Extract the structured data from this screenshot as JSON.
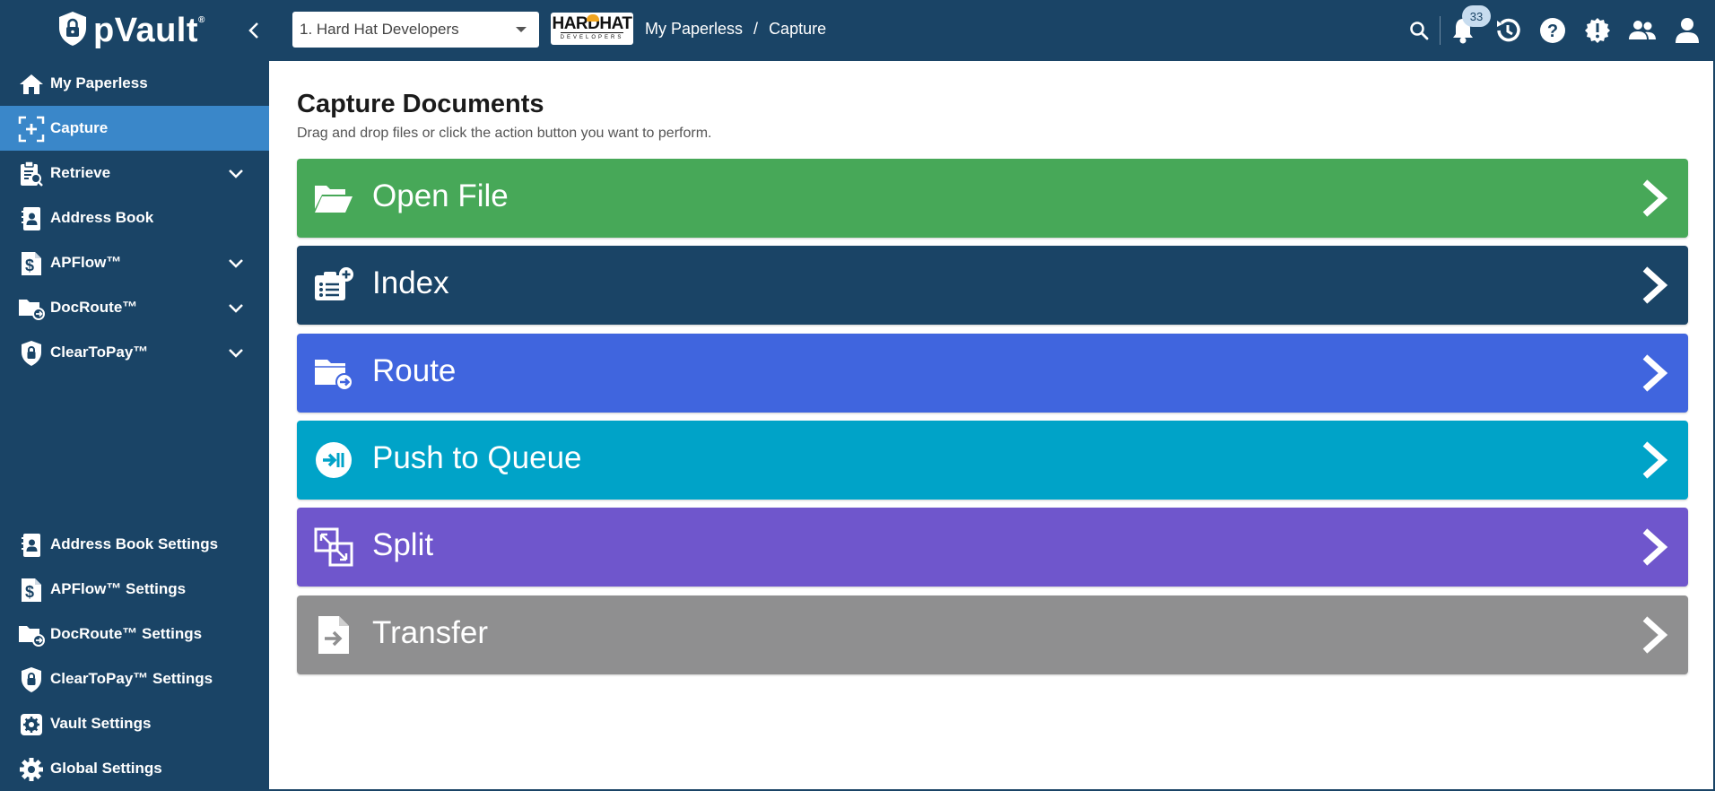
{
  "app": {
    "logo_text": "pVault",
    "logo_mark": "®"
  },
  "header": {
    "company_select_value": "1. Hard Hat Developers",
    "company_logo_text": "HARDHAT",
    "company_logo_subtext": "DEVELOPERS",
    "breadcrumb": [
      {
        "label": "My Paperless"
      },
      {
        "separator": "/"
      },
      {
        "label": "Capture"
      }
    ],
    "notification_count": "33",
    "icons": [
      "search-icon",
      "bell-icon",
      "history-icon",
      "help-icon",
      "alert-icon",
      "users-icon",
      "account-icon"
    ]
  },
  "sidebar": {
    "top_items": [
      {
        "label": "My Paperless",
        "icon": "home-icon",
        "expandable": false,
        "active": false
      },
      {
        "label": "Capture",
        "icon": "capture-icon",
        "expandable": false,
        "active": true
      },
      {
        "label": "Retrieve",
        "icon": "retrieve-icon",
        "expandable": true,
        "active": false
      },
      {
        "label": "Address Book",
        "icon": "address-book-icon",
        "expandable": false,
        "active": false
      },
      {
        "label": "APFlow™",
        "icon": "apflow-icon",
        "expandable": true,
        "active": false
      },
      {
        "label": "DocRoute™",
        "icon": "docroute-icon",
        "expandable": true,
        "active": false
      },
      {
        "label": "ClearToPay™",
        "icon": "cleartopay-icon",
        "expandable": true,
        "active": false
      }
    ],
    "bottom_items": [
      {
        "label": "Address Book Settings",
        "icon": "address-book-icon"
      },
      {
        "label": "APFlow™ Settings",
        "icon": "apflow-icon"
      },
      {
        "label": "DocRoute™ Settings",
        "icon": "docroute-icon"
      },
      {
        "label": "ClearToPay™ Settings",
        "icon": "cleartopay-icon"
      },
      {
        "label": "Vault Settings",
        "icon": "gear-box-icon"
      },
      {
        "label": "Global Settings",
        "icon": "gear-icon"
      }
    ]
  },
  "main": {
    "title": "Capture Documents",
    "subtitle": "Drag and drop files or click the action button you want to perform.",
    "actions": [
      {
        "label": "Open File",
        "icon": "folder-open-icon",
        "color": "#47a858"
      },
      {
        "label": "Index",
        "icon": "index-icon",
        "color": "#1a4466"
      },
      {
        "label": "Route",
        "icon": "route-icon",
        "color": "#4065de"
      },
      {
        "label": "Push to Queue",
        "icon": "push-queue-icon",
        "color": "#00a3c8"
      },
      {
        "label": "Split",
        "icon": "split-icon",
        "color": "#6f56cc"
      },
      {
        "label": "Transfer",
        "icon": "transfer-icon",
        "color": "#8f8f90"
      }
    ]
  },
  "colors": {
    "navy": "#1a4466",
    "active_nav": "#3a87c9"
  }
}
